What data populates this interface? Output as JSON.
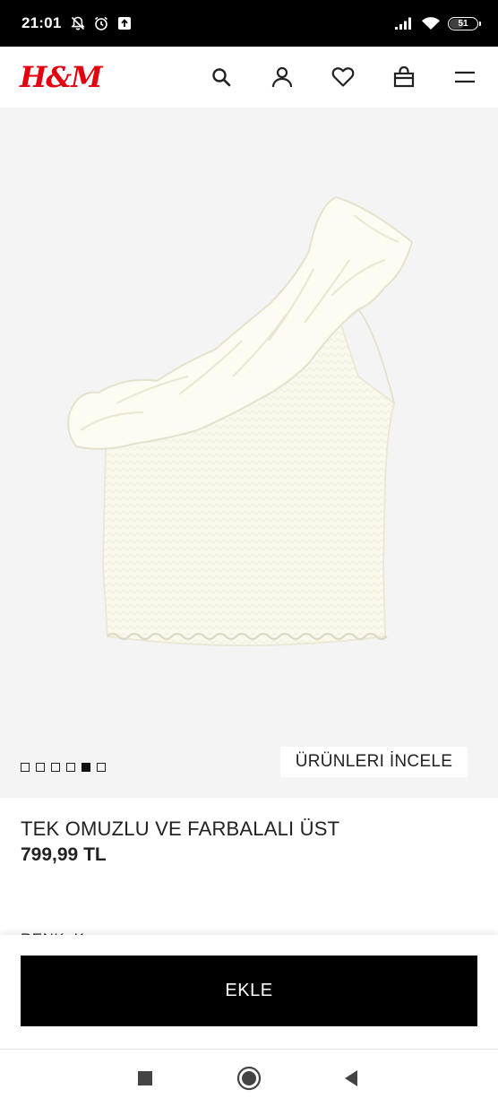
{
  "status_bar": {
    "time": "21:01",
    "battery_level": "51",
    "icons": [
      "bell-off-icon",
      "alarm-icon",
      "upload-icon",
      "signal-icon",
      "wifi-icon",
      "battery-icon"
    ]
  },
  "header": {
    "logo": "H&M",
    "icons": [
      "search-icon",
      "account-icon",
      "heart-icon",
      "bag-icon",
      "menu-icon"
    ]
  },
  "gallery": {
    "dots_total": 6,
    "active_dot": 5,
    "inspect_label": "ÜRÜNLERI İNCELE"
  },
  "product": {
    "title": "TEK OMUZLU VE FARBALALI ÜST",
    "price": "799,99 TL",
    "color_label": "RENK: K"
  },
  "actions": {
    "add_label": "EKLE"
  },
  "nav": {
    "icons": [
      "recents-square-icon",
      "home-circle-icon",
      "back-triangle-icon"
    ]
  },
  "colors": {
    "brand_red": "#e50010",
    "button_black": "#000000",
    "image_bg": "#f4f4f4",
    "garment": "#fbf9ee"
  }
}
